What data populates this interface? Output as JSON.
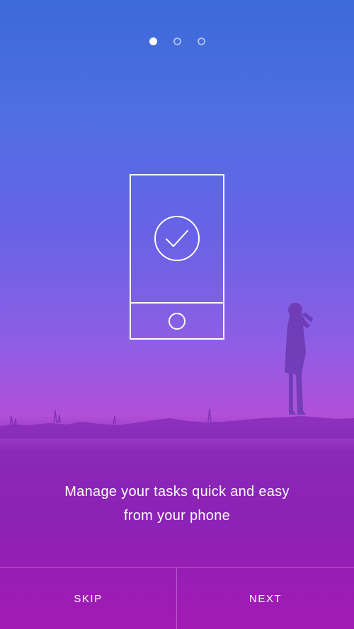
{
  "pager": {
    "total": 3,
    "active_index": 0
  },
  "illustration": {
    "device_icon": "phone-outline-icon",
    "status_icon": "checkmark-circle-icon",
    "home_button_icon": "home-button-icon"
  },
  "caption": {
    "line1": "Manage your tasks quick and easy",
    "line2": "from your phone"
  },
  "footer": {
    "skip_label": "SKIP",
    "next_label": "NEXT"
  },
  "colors": {
    "gradient_top": "#3b6ad8",
    "gradient_mid": "#8f5ee4",
    "gradient_bottom": "#a21ab4",
    "foreground": "#ffffff",
    "silhouette": "#7e2bb4"
  }
}
